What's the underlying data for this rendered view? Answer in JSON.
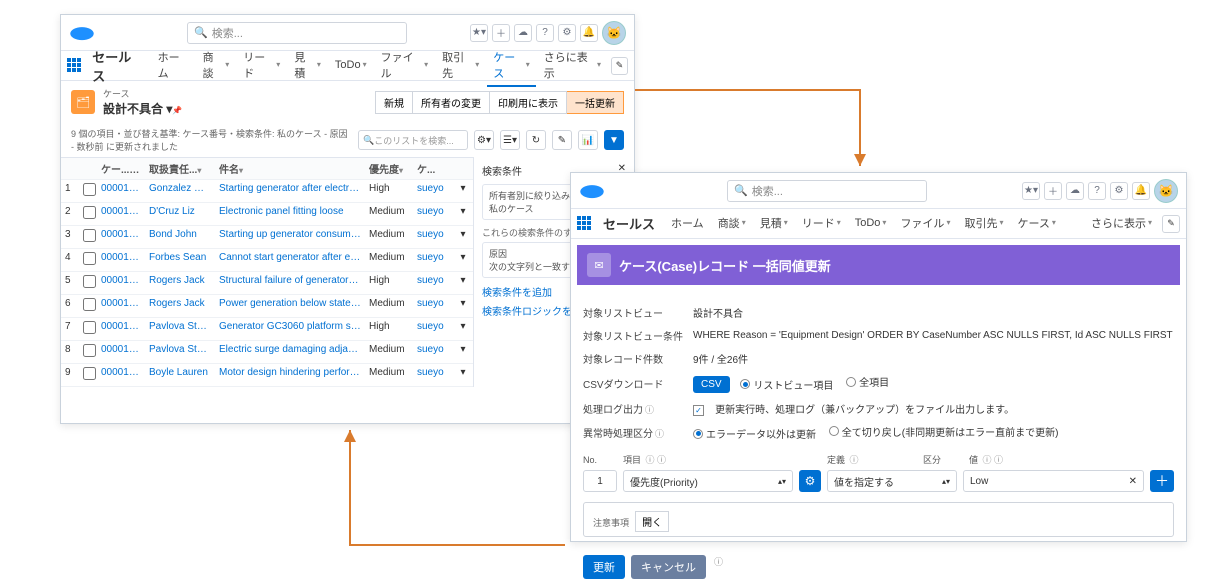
{
  "app": {
    "name": "セールス",
    "search_placeholder": "検索..."
  },
  "nav": {
    "tabs": [
      "ホーム",
      "商談",
      "リード",
      "見積",
      "ToDo",
      "ファイル",
      "取引先",
      "ケース"
    ],
    "more": "さらに表示",
    "active": 7
  },
  "list": {
    "object": "ケース",
    "view": "設計不具合",
    "meta": "9 個の項目・並び替え基準: ケース番号・検索条件: 私のケース - 原因 - 数秒前 に更新されました",
    "buttons": [
      "新規",
      "所有者の変更",
      "印刷用に表示",
      "一括更新"
    ],
    "search_placeholder": "このリストを検索...",
    "columns": [
      "",
      "",
      "ケー...",
      "取扱責任...",
      "件名",
      "優先度",
      "ケ...",
      ""
    ],
    "rows": [
      {
        "n": "1",
        "case": "000010...",
        "owner": "Gonzalez Ro...",
        "subject": "Starting generator after electrica...",
        "priority": "High",
        "who": "sueyo"
      },
      {
        "n": "2",
        "case": "000010...",
        "owner": "D'Cruz Liz",
        "subject": "Electronic panel fitting loose",
        "priority": "Medium",
        "who": "sueyo"
      },
      {
        "n": "3",
        "case": "000010...",
        "owner": "Bond John",
        "subject": "Starting up generator consumes...",
        "priority": "Medium",
        "who": "sueyo"
      },
      {
        "n": "4",
        "case": "000010...",
        "owner": "Forbes Sean",
        "subject": "Cannot start generator after elec...",
        "priority": "Medium",
        "who": "sueyo"
      },
      {
        "n": "5",
        "case": "000010...",
        "owner": "Rogers Jack",
        "subject": "Structural failure of generator ba...",
        "priority": "High",
        "who": "sueyo"
      },
      {
        "n": "6",
        "case": "000010...",
        "owner": "Rogers Jack",
        "subject": "Power generation below stated l...",
        "priority": "Medium",
        "who": "sueyo"
      },
      {
        "n": "7",
        "case": "000010...",
        "owner": "Pavlova Stella",
        "subject": "Generator GC3060 platform stru...",
        "priority": "High",
        "who": "sueyo"
      },
      {
        "n": "8",
        "case": "000010...",
        "owner": "Pavlova Stella",
        "subject": "Electric surge damaging adjacen...",
        "priority": "Medium",
        "who": "sueyo"
      },
      {
        "n": "9",
        "case": "000010...",
        "owner": "Boyle Lauren",
        "subject": "Motor design hindering perform...",
        "priority": "Medium",
        "who": "sueyo"
      }
    ]
  },
  "side": {
    "title": "検索条件",
    "box1a": "所有者別に絞り込み",
    "box1b": "私のケース",
    "box2a": "これらの検索条件のすべてに…",
    "box2b": "原因",
    "box2c": "次の文字列と一致する  Equi",
    "add1": "検索条件を追加",
    "add2": "検索条件ロジックを追加"
  },
  "update": {
    "title": "ケース(Case)レコード 一括同値更新",
    "rows": {
      "target_view_label": "対象リストビュー",
      "target_view": "設計不具合",
      "cond_label": "対象リストビュー条件",
      "cond": "WHERE  Reason = 'Equipment Design'  ORDER BY  CaseNumber ASC NULLS FIRST, Id ASC NULLS FIRST",
      "count_label": "対象レコード件数",
      "count": "9件 / 全26件",
      "csv_label": "CSVダウンロード",
      "csv_btn": "CSV",
      "csv_opt1": "リストビュー項目",
      "csv_opt2": "全項目",
      "log_label": "処理ログ出力",
      "log_desc": "更新実行時、処理ログ（兼バックアップ）をファイル出力します。",
      "err_label": "異常時処理区分",
      "err_opt1": "エラーデータ以外は更新",
      "err_opt2": "全て切り戻し(非同期更新はエラー直前まで更新)"
    },
    "field": {
      "no_label": "No.",
      "no": "1",
      "item_label": "項目",
      "item": "優先度(Priority)",
      "def_label": "定義",
      "def": "値を指定する",
      "kubun_label": "区分",
      "val_label": "値",
      "val": "Low"
    },
    "notes_label": "注意事項",
    "open": "開く",
    "update": "更新",
    "cancel": "キャンセル"
  }
}
